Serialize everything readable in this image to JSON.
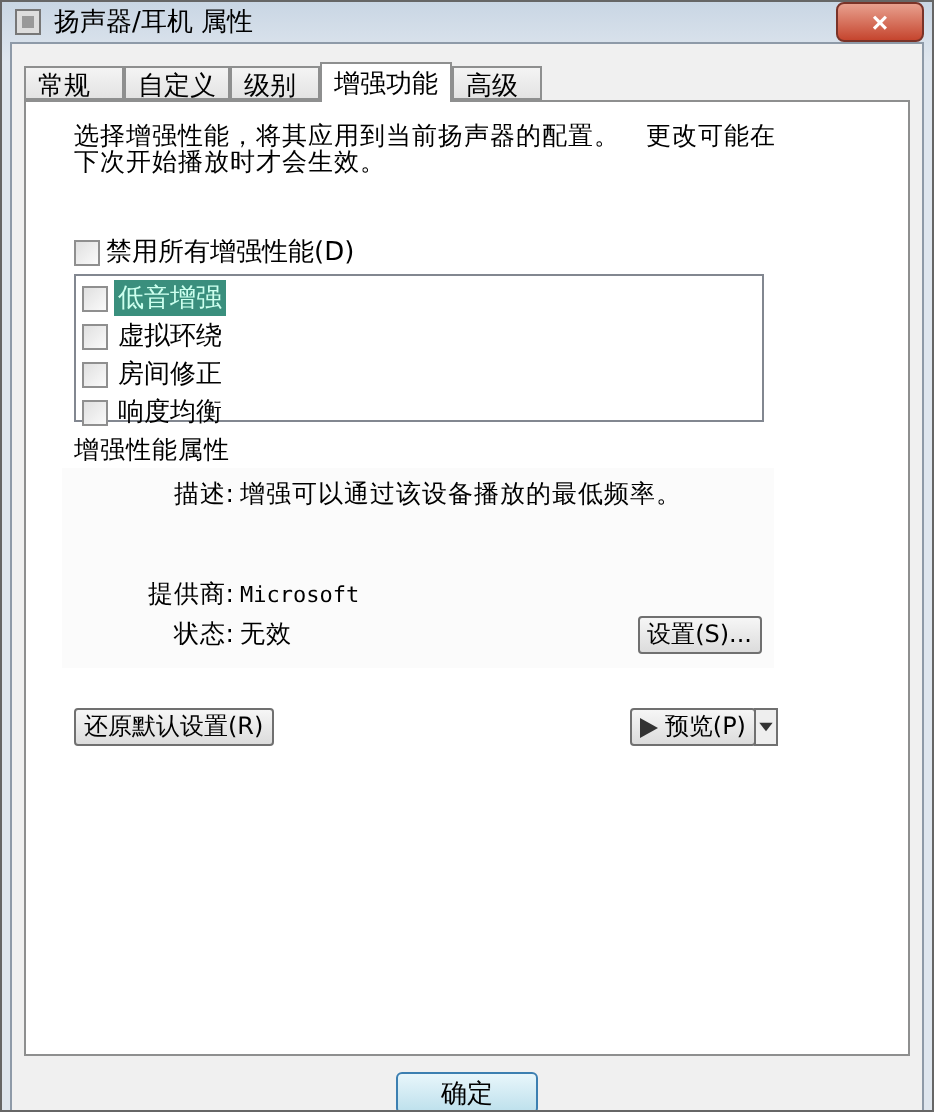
{
  "window": {
    "title": "扬声器/耳机 属性",
    "close": "×"
  },
  "tabs": [
    {
      "label": "常规",
      "selected": false
    },
    {
      "label": "自定义",
      "selected": false
    },
    {
      "label": "级别",
      "selected": false
    },
    {
      "label": "增强功能",
      "selected": true
    },
    {
      "label": "高级",
      "selected": false
    }
  ],
  "intro": "选择增强性能，将其应用到当前扬声器的配置。　更改可能在下次开始播放时才会生效。",
  "disable_all": {
    "label": "禁用所有增强性能(D)",
    "checked": false
  },
  "enhancements": [
    {
      "label": "低音增强",
      "checked": false,
      "selected": true
    },
    {
      "label": "虚拟环绕",
      "checked": false,
      "selected": false
    },
    {
      "label": "房间修正",
      "checked": false,
      "selected": false
    },
    {
      "label": "响度均衡",
      "checked": false,
      "selected": false
    }
  ],
  "properties": {
    "title": "增强性能属性",
    "description_label": "描述:",
    "description": "增强可以通过该设备播放的最低频率。",
    "provider_label": "提供商:",
    "provider": "Microsoft",
    "status_label": "状态:",
    "status": "无效",
    "settings_button": "设置(S)..."
  },
  "restore_button": "还原默认设置(R)",
  "preview_button": "预览(P)",
  "ok_button": "确定"
}
